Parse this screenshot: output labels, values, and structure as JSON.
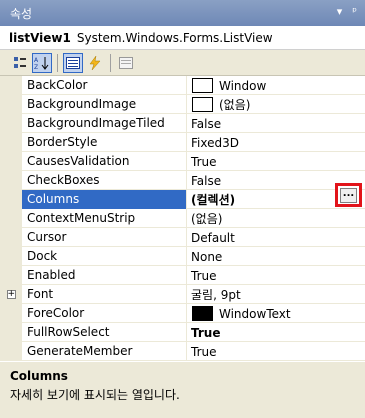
{
  "window": {
    "title": "속성",
    "pin_glyph": "▾",
    "dock_glyph": "ᵖ"
  },
  "object": {
    "name": "listView1",
    "type": "System.Windows.Forms.ListView"
  },
  "toolbar": {
    "categorized_icon": "categorized-icon",
    "alphabetical_icon": "alphabetical-icon",
    "properties_icon": "properties-icon",
    "events_icon": "events-icon",
    "property_pages_icon": "property-pages-icon"
  },
  "properties": [
    {
      "name": "BackColor",
      "value": "Window",
      "swatch": "#ffffff"
    },
    {
      "name": "BackgroundImage",
      "value": "(없음)",
      "swatch": "#ffffff"
    },
    {
      "name": "BackgroundImageTiled",
      "value": "False"
    },
    {
      "name": "BorderStyle",
      "value": "Fixed3D"
    },
    {
      "name": "CausesValidation",
      "value": "True"
    },
    {
      "name": "CheckBoxes",
      "value": "False"
    },
    {
      "name": "Columns",
      "value": "(컬렉션)",
      "bold": true,
      "selected": true,
      "ellipsis": "..."
    },
    {
      "name": "ContextMenuStrip",
      "value": "(없음)"
    },
    {
      "name": "Cursor",
      "value": "Default"
    },
    {
      "name": "Dock",
      "value": "None"
    },
    {
      "name": "Enabled",
      "value": "True"
    },
    {
      "name": "Font",
      "value": "굴림, 9pt",
      "expandable": true,
      "expander": "+"
    },
    {
      "name": "ForeColor",
      "value": "WindowText",
      "swatch": "#000000"
    },
    {
      "name": "FullRowSelect",
      "value": "True",
      "bold": true
    },
    {
      "name": "GenerateMember",
      "value": "True"
    }
  ],
  "description": {
    "title": "Columns",
    "text": "자세히 보기에 표시되는 열입니다."
  }
}
